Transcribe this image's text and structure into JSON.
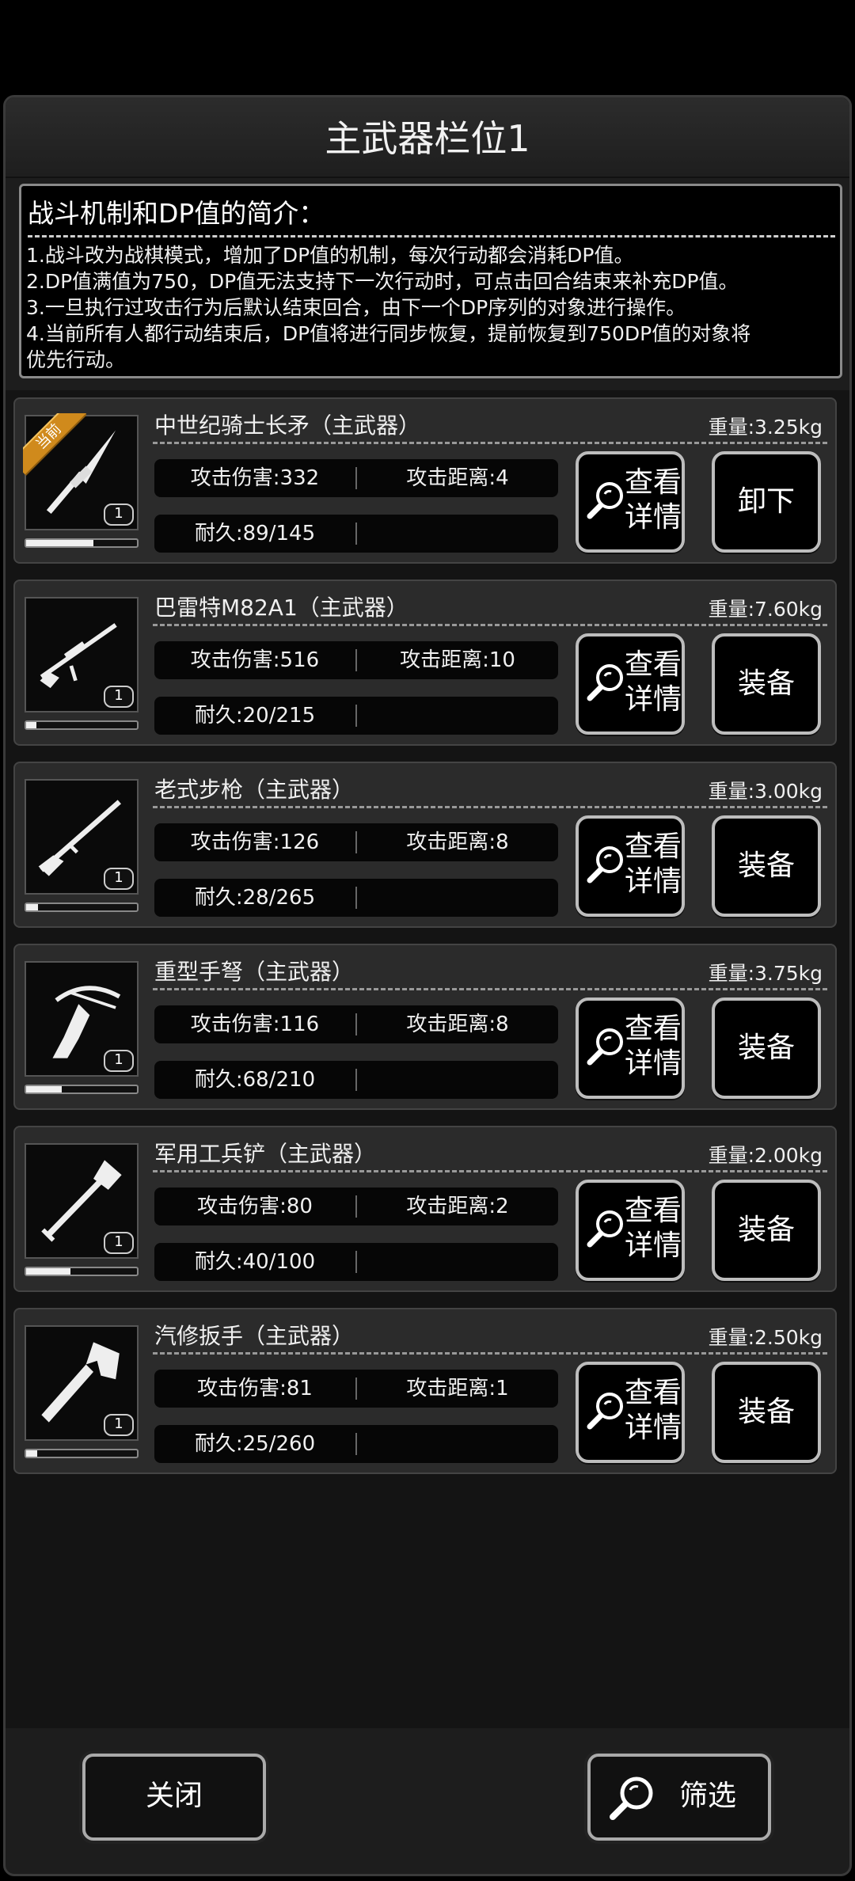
{
  "dialog": {
    "title": "主武器栏位1"
  },
  "info": {
    "heading": "战斗机制和DP值的简介：",
    "lines": [
      "1.战斗改为战棋模式，增加了DP值的机制，每次行动都会消耗DP值。",
      "2.DP值满值为750，DP值无法支持下一次行动时，可点击回合结束来补充DP值。",
      "3.一旦执行过攻击行为后默认结束回合，由下一个DP序列的对象进行操作。",
      "4.当前所有人都行动结束后，DP值将进行同步恢复，提前恢复到750DP值的对象将",
      "优先行动。"
    ]
  },
  "weapons": [
    {
      "name": "中世纪骑士长矛（主武器）",
      "weight": "重量:3.25kg",
      "attack": "攻击伤害:332",
      "range": "攻击距离:4",
      "durability": "耐久:89/145",
      "durability_ratio": 0.61,
      "count": "1",
      "tag": "当前",
      "detail": "查看详情",
      "detail_l1": "查看",
      "detail_l2": "详情",
      "action": "卸下",
      "icon": "lance-icon"
    },
    {
      "name": "巴雷特M82A1（主武器）",
      "weight": "重量:7.60kg",
      "attack": "攻击伤害:516",
      "range": "攻击距离:10",
      "durability": "耐久:20/215",
      "durability_ratio": 0.09,
      "count": "1",
      "detail_l1": "查看",
      "detail_l2": "详情",
      "action": "装备",
      "icon": "sniper-rifle-icon"
    },
    {
      "name": "老式步枪（主武器）",
      "weight": "重量:3.00kg",
      "attack": "攻击伤害:126",
      "range": "攻击距离:8",
      "durability": "耐久:28/265",
      "durability_ratio": 0.11,
      "count": "1",
      "detail_l1": "查看",
      "detail_l2": "详情",
      "action": "装备",
      "icon": "rifle-icon"
    },
    {
      "name": "重型手弩（主武器）",
      "weight": "重量:3.75kg",
      "attack": "攻击伤害:116",
      "range": "攻击距离:8",
      "durability": "耐久:68/210",
      "durability_ratio": 0.32,
      "count": "1",
      "detail_l1": "查看",
      "detail_l2": "详情",
      "action": "装备",
      "icon": "crossbow-icon"
    },
    {
      "name": "军用工兵铲（主武器）",
      "weight": "重量:2.00kg",
      "attack": "攻击伤害:80",
      "range": "攻击距离:2",
      "durability": "耐久:40/100",
      "durability_ratio": 0.4,
      "count": "1",
      "detail_l1": "查看",
      "detail_l2": "详情",
      "action": "装备",
      "icon": "shovel-icon"
    },
    {
      "name": "汽修扳手（主武器）",
      "weight": "重量:2.50kg",
      "attack": "攻击伤害:81",
      "range": "攻击距离:1",
      "durability": "耐久:25/260",
      "durability_ratio": 0.1,
      "count": "1",
      "detail_l1": "查看",
      "detail_l2": "详情",
      "action": "装备",
      "icon": "wrench-icon"
    }
  ],
  "footer": {
    "close_label": "关闭",
    "filter_label": "筛选"
  }
}
